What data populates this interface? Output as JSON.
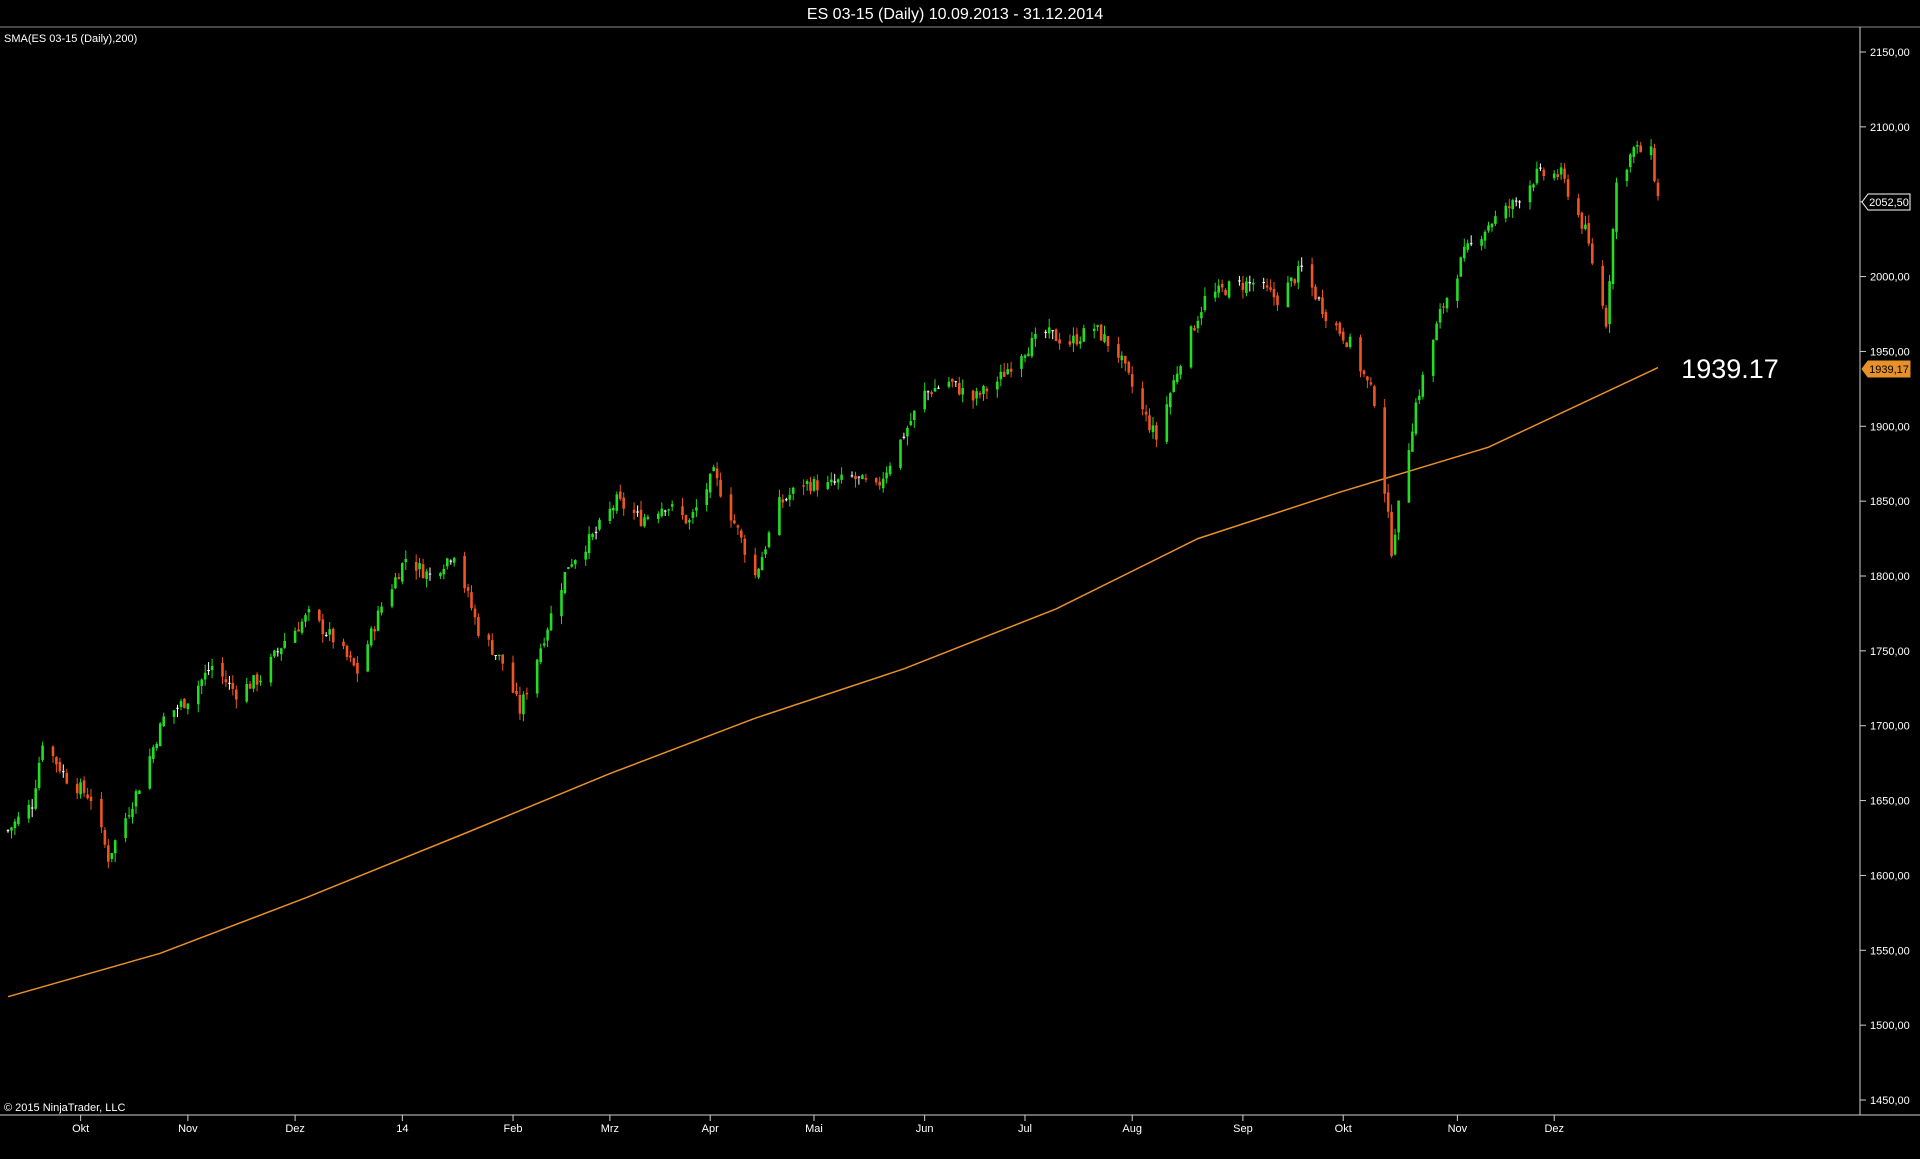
{
  "window": {
    "title": "ES 03-15 (Daily)  10.09.2013 - 31.12.2014"
  },
  "indicator_label": "SMA(ES 03-15 (Daily),200)",
  "copyright": "© 2015 NinjaTrader, LLC",
  "last_price_label": "2052,50",
  "sma_label": "1939,17",
  "sma_annotation": "1939.17",
  "colors": {
    "background": "#000000",
    "up_candle": "#22dd22",
    "down_candle": "#ee5522",
    "doji": "#ffffff",
    "sma_line": "#e8902a",
    "axis": "#cfcfcf",
    "text": "#ffffff"
  },
  "chart_data": {
    "type": "candlestick",
    "symbol": "ES 03-15 (Daily)",
    "date_range": [
      "10.09.2013",
      "31.12.2014"
    ],
    "ylim": [
      1450,
      2150
    ],
    "y_ticks": [
      "2150,00",
      "2100,00",
      "2050,00",
      "2000,00",
      "1950,00",
      "1900,00",
      "1850,00",
      "1800,00",
      "1750,00",
      "1700,00",
      "1650,00",
      "1600,00",
      "1550,00",
      "1500,00",
      "1450,00"
    ],
    "x_ticks": [
      "Okt",
      "Nov",
      "Dez",
      "14",
      "Feb",
      "Mrz",
      "Apr",
      "Mai",
      "Jun",
      "Jul",
      "Aug",
      "Sep",
      "Okt",
      "Nov",
      "Dez"
    ],
    "price_path": [
      [
        "10.09.2013",
        1630
      ],
      [
        "17.09.2013",
        1648
      ],
      [
        "20.09.2013",
        1690
      ],
      [
        "27.09.2013",
        1665
      ],
      [
        "04.10.2013",
        1652
      ],
      [
        "09.10.2013",
        1612
      ],
      [
        "18.10.2013",
        1660
      ],
      [
        "25.10.2013",
        1705
      ],
      [
        "01.11.2013",
        1718
      ],
      [
        "08.11.2013",
        1740
      ],
      [
        "15.11.2013",
        1722
      ],
      [
        "22.11.2013",
        1732
      ],
      [
        "29.11.2013",
        1757
      ],
      [
        "06.12.2013",
        1774
      ],
      [
        "13.12.2013",
        1758
      ],
      [
        "20.12.2013",
        1736
      ],
      [
        "27.12.2013",
        1780
      ],
      [
        "03.01.2014",
        1812
      ],
      [
        "10.01.2014",
        1800
      ],
      [
        "17.01.2014",
        1816
      ],
      [
        "24.01.2014",
        1764
      ],
      [
        "31.01.2014",
        1742
      ],
      [
        "05.02.2014",
        1710
      ],
      [
        "12.02.2014",
        1760
      ],
      [
        "19.02.2014",
        1808
      ],
      [
        "26.02.2014",
        1826
      ],
      [
        "05.03.2014",
        1850
      ],
      [
        "12.03.2014",
        1838
      ],
      [
        "19.03.2014",
        1848
      ],
      [
        "26.03.2014",
        1836
      ],
      [
        "02.04.2014",
        1868
      ],
      [
        "09.04.2014",
        1830
      ],
      [
        "14.04.2014",
        1800
      ],
      [
        "21.04.2014",
        1848
      ],
      [
        "28.04.2014",
        1862
      ],
      [
        "05.05.2014",
        1860
      ],
      [
        "12.05.2014",
        1866
      ],
      [
        "19.05.2014",
        1858
      ],
      [
        "26.05.2014",
        1890
      ],
      [
        "02.06.2014",
        1922
      ],
      [
        "09.06.2014",
        1930
      ],
      [
        "16.06.2014",
        1918
      ],
      [
        "23.06.2014",
        1930
      ],
      [
        "30.06.2014",
        1950
      ],
      [
        "07.07.2014",
        1962
      ],
      [
        "14.07.2014",
        1956
      ],
      [
        "21.07.2014",
        1966
      ],
      [
        "28.07.2014",
        1948
      ],
      [
        "04.08.2014",
        1910
      ],
      [
        "08.08.2014",
        1892
      ],
      [
        "15.08.2014",
        1945
      ],
      [
        "22.08.2014",
        1985
      ],
      [
        "29.08.2014",
        1993
      ],
      [
        "05.09.2014",
        1996
      ],
      [
        "12.09.2014",
        1985
      ],
      [
        "19.09.2014",
        2005
      ],
      [
        "26.09.2014",
        1975
      ],
      [
        "03.10.2014",
        1955
      ],
      [
        "10.10.2014",
        1918
      ],
      [
        "15.10.2014",
        1818
      ],
      [
        "22.10.2014",
        1915
      ],
      [
        "29.10.2014",
        1975
      ],
      [
        "05.11.2014",
        2015
      ],
      [
        "12.11.2014",
        2035
      ],
      [
        "19.11.2014",
        2048
      ],
      [
        "26.11.2014",
        2068
      ],
      [
        "03.12.2014",
        2068
      ],
      [
        "10.12.2014",
        2030
      ],
      [
        "16.12.2014",
        1970
      ],
      [
        "19.12.2014",
        2062
      ],
      [
        "24.12.2014",
        2085
      ],
      [
        "29.12.2014",
        2082
      ],
      [
        "31.12.2014",
        2052.5
      ]
    ],
    "series": [
      {
        "name": "SMA(ES 03-15 (Daily),200)",
        "type": "line",
        "values": [
          [
            "10.09.2013",
            1519
          ],
          [
            "24.10.2013",
            1548
          ],
          [
            "05.12.2013",
            1585
          ],
          [
            "20.01.2014",
            1628
          ],
          [
            "03.03.2014",
            1668
          ],
          [
            "14.04.2014",
            1705
          ],
          [
            "27.05.2014",
            1738
          ],
          [
            "10.07.2014",
            1778
          ],
          [
            "20.08.2014",
            1825
          ],
          [
            "30.09.2014",
            1856
          ],
          [
            "12.11.2014",
            1886
          ],
          [
            "31.12.2014",
            1939.17
          ]
        ]
      }
    ],
    "last_close": 2052.5,
    "sma_last": 1939.17
  }
}
